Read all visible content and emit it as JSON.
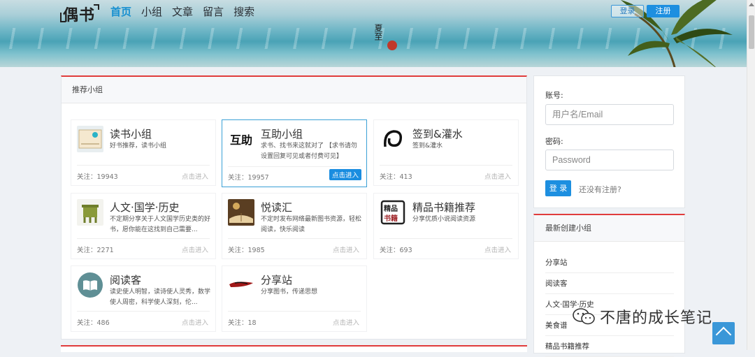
{
  "header": {
    "logo": "偶书",
    "nav": [
      "首页",
      "小组",
      "文章",
      "留言",
      "搜索"
    ],
    "seal_text": "夏至",
    "login_label": "登录",
    "register_label": "注册"
  },
  "groups_panel": {
    "title": "推荐小组",
    "cards": [
      {
        "title": "读书小组",
        "desc": "好书推荐，读书小组",
        "followers": "关注：19943",
        "enter": "点击进入",
        "icon": "reading-book-icon"
      },
      {
        "title": "互助小组",
        "desc": "求书、找书来这就对了 【求书请勿设置回复可见或者付费可见】",
        "followers": "关注：19957",
        "enter": "点击进入",
        "icon": "calligraphy-huzhu-icon"
      },
      {
        "title": "签到&灌水",
        "desc": "签到&灌水",
        "followers": "关注：413",
        "enter": "点击进入",
        "icon": "swirl-logo-icon"
      },
      {
        "title": "人文·国学·历史",
        "desc": "不定期分享关于人文国学历史类的好书，愿你能在这找到自己需要...",
        "followers": "关注：2271",
        "enter": "点击进入",
        "icon": "bronze-ding-icon"
      },
      {
        "title": "悦读汇",
        "desc": "不定时发布网络最新图书资源，轻松阅读，快乐阅读",
        "followers": "关注：1985",
        "enter": "点击进入",
        "icon": "open-book-photo-icon"
      },
      {
        "title": "精品书籍推荐",
        "desc": "分享优质小说阅读资源",
        "followers": "关注：693",
        "enter": "点击进入",
        "icon": "jingpin-shuji-seal-icon"
      },
      {
        "title": "阅读客",
        "desc": "读史使人明智，读诗使人灵秀，数学使人周密，科学使人深刻，伦...",
        "followers": "关注：486",
        "enter": "点击进入",
        "icon": "book-circle-icon"
      },
      {
        "title": "分享站",
        "desc": "分享图书，传递思想",
        "followers": "关注：18",
        "enter": "点击进入",
        "icon": "brush-stroke-icon"
      }
    ]
  },
  "login_box": {
    "account_label": "账号:",
    "account_placeholder": "用户名/Email",
    "password_label": "密码:",
    "password_placeholder": "Password",
    "login_button": "登 录",
    "no_register": "还没有注册?"
  },
  "new_groups": {
    "title": "最新创建小组",
    "items": [
      "分享站",
      "阅读客",
      "人文·国学·历史",
      "美食谱",
      "精品书籍推荐"
    ]
  },
  "watermark": "不唐的成长笔记",
  "colors": {
    "accent": "#1d8fe0",
    "panel_top": "#e03c3c"
  }
}
